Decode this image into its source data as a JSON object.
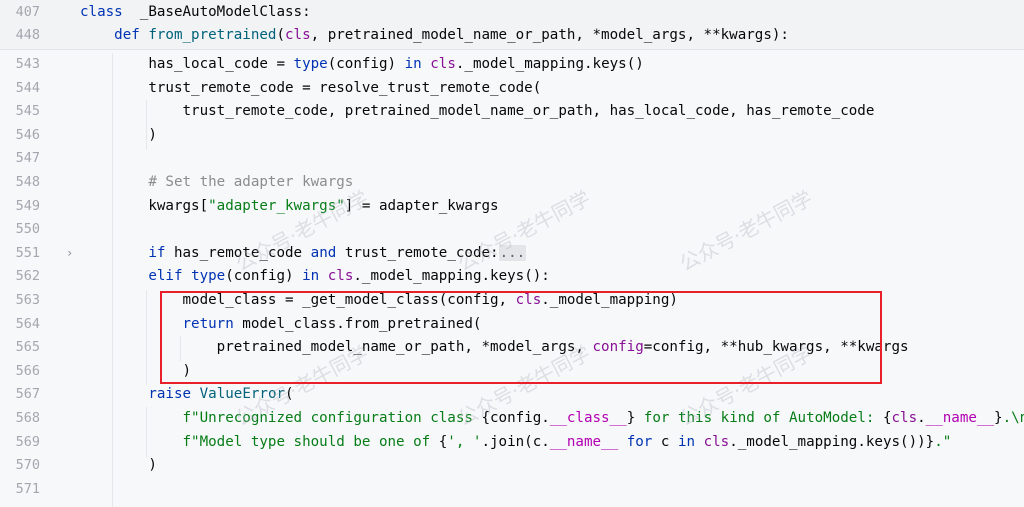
{
  "sticky": [
    {
      "ln": "407",
      "parts": [
        [
          "kw",
          "class"
        ],
        [
          "",
          "  _BaseAutoModelClass:"
        ]
      ]
    },
    {
      "ln": "448",
      "parts": [
        [
          "",
          "    "
        ],
        [
          "kw",
          "def"
        ],
        [
          "",
          " "
        ],
        [
          "fn",
          "from_pretrained"
        ],
        [
          "",
          "("
        ],
        [
          "cls",
          "cls"
        ],
        [
          "",
          ", pretrained_model_name_or_path, *model_args, **kwargs):"
        ]
      ]
    }
  ],
  "lines": [
    {
      "ln": "543",
      "parts": [
        [
          "",
          "        has_local_code = "
        ],
        [
          "kw",
          "type"
        ],
        [
          "",
          "(config) "
        ],
        [
          "kw",
          "in"
        ],
        [
          "",
          " "
        ],
        [
          "cls",
          "cls"
        ],
        [
          "",
          "._model_mapping.keys()"
        ]
      ]
    },
    {
      "ln": "544",
      "parts": [
        [
          "",
          "        trust_remote_code = resolve_trust_remote_code("
        ]
      ]
    },
    {
      "ln": "545",
      "parts": [
        [
          "",
          "            trust_remote_code, pretrained_model_name_or_path, has_local_code, has_remote_code"
        ]
      ]
    },
    {
      "ln": "546",
      "parts": [
        [
          "",
          "        )"
        ]
      ]
    },
    {
      "ln": "547",
      "parts": [
        [
          "",
          ""
        ]
      ]
    },
    {
      "ln": "548",
      "parts": [
        [
          "cmt",
          "        # Set the adapter kwargs"
        ]
      ]
    },
    {
      "ln": "549",
      "parts": [
        [
          "",
          "        kwargs["
        ],
        [
          "str",
          "\"adapter_kwargs\""
        ],
        [
          "",
          "] = adapter_kwargs"
        ]
      ]
    },
    {
      "ln": "550",
      "parts": [
        [
          "",
          ""
        ]
      ]
    },
    {
      "ln": "551",
      "fold": true,
      "parts": [
        [
          "",
          "        "
        ],
        [
          "kw",
          "if"
        ],
        [
          "",
          " has_remote_code "
        ],
        [
          "kw",
          "and"
        ],
        [
          "",
          " trust_remote_code:"
        ],
        [
          "folded",
          "..."
        ]
      ]
    },
    {
      "ln": "562",
      "parts": [
        [
          "",
          "        "
        ],
        [
          "kw",
          "elif"
        ],
        [
          "",
          " "
        ],
        [
          "kw",
          "type"
        ],
        [
          "",
          "(config) "
        ],
        [
          "kw",
          "in"
        ],
        [
          "",
          " "
        ],
        [
          "cls",
          "cls"
        ],
        [
          "",
          "._model_mapping.keys():"
        ]
      ]
    },
    {
      "ln": "563",
      "parts": [
        [
          "",
          "            model_class = _get_model_class(config, "
        ],
        [
          "cls",
          "cls"
        ],
        [
          "",
          "._model_mapping)"
        ]
      ]
    },
    {
      "ln": "564",
      "parts": [
        [
          "",
          "            "
        ],
        [
          "kw",
          "return"
        ],
        [
          "",
          " model_class.from_pretrained("
        ]
      ]
    },
    {
      "ln": "565",
      "parts": [
        [
          "",
          "                pretrained_model_name_or_path, *model_args, "
        ],
        [
          "kwarg",
          "config"
        ],
        [
          "",
          "=config, **hub_kwargs, **kwargs"
        ]
      ]
    },
    {
      "ln": "566",
      "parts": [
        [
          "",
          "            )"
        ]
      ]
    },
    {
      "ln": "567",
      "parts": [
        [
          "",
          "        "
        ],
        [
          "kw",
          "raise"
        ],
        [
          "",
          " "
        ],
        [
          "fn",
          "ValueError"
        ],
        [
          "",
          "("
        ]
      ]
    },
    {
      "ln": "568",
      "parts": [
        [
          "",
          "            "
        ],
        [
          "str",
          "f\"Unrecognized configuration class "
        ],
        [
          "",
          "{config."
        ],
        [
          "dunder",
          "__class__"
        ],
        [
          "",
          "}"
        ],
        [
          "str",
          " for this kind of AutoModel: "
        ],
        [
          "",
          "{"
        ],
        [
          "cls",
          "cls"
        ],
        [
          "",
          "."
        ],
        [
          "dunder",
          "__name__"
        ],
        [
          "",
          "}"
        ],
        [
          "str",
          ".\\n\""
        ]
      ]
    },
    {
      "ln": "569",
      "parts": [
        [
          "",
          "            "
        ],
        [
          "str",
          "f\"Model type should be one of "
        ],
        [
          "",
          "{"
        ],
        [
          "str",
          "', '"
        ],
        [
          "",
          ".join(c."
        ],
        [
          "dunder",
          "__name__"
        ],
        [
          "",
          " "
        ],
        [
          "kw",
          "for"
        ],
        [
          "",
          " c "
        ],
        [
          "kw",
          "in"
        ],
        [
          "",
          " "
        ],
        [
          "cls",
          "cls"
        ],
        [
          "",
          "._model_mapping.keys())}"
        ],
        [
          "str",
          ".\""
        ]
      ]
    },
    {
      "ln": "570",
      "parts": [
        [
          "",
          "        )"
        ]
      ]
    },
    {
      "ln": "571",
      "parts": [
        [
          "",
          ""
        ]
      ]
    }
  ],
  "fold_icon": "chevron-right-icon",
  "watermarks": [
    {
      "text": "公众号·老牛同学"
    },
    {
      "text": "公众号·老牛同学"
    },
    {
      "text": "公众号·老牛同学"
    },
    {
      "text": "公众号·老牛同学"
    },
    {
      "text": "公众号·老牛同学"
    },
    {
      "text": "公众号·老牛同学"
    }
  ],
  "highlight_color": "#e8202a"
}
